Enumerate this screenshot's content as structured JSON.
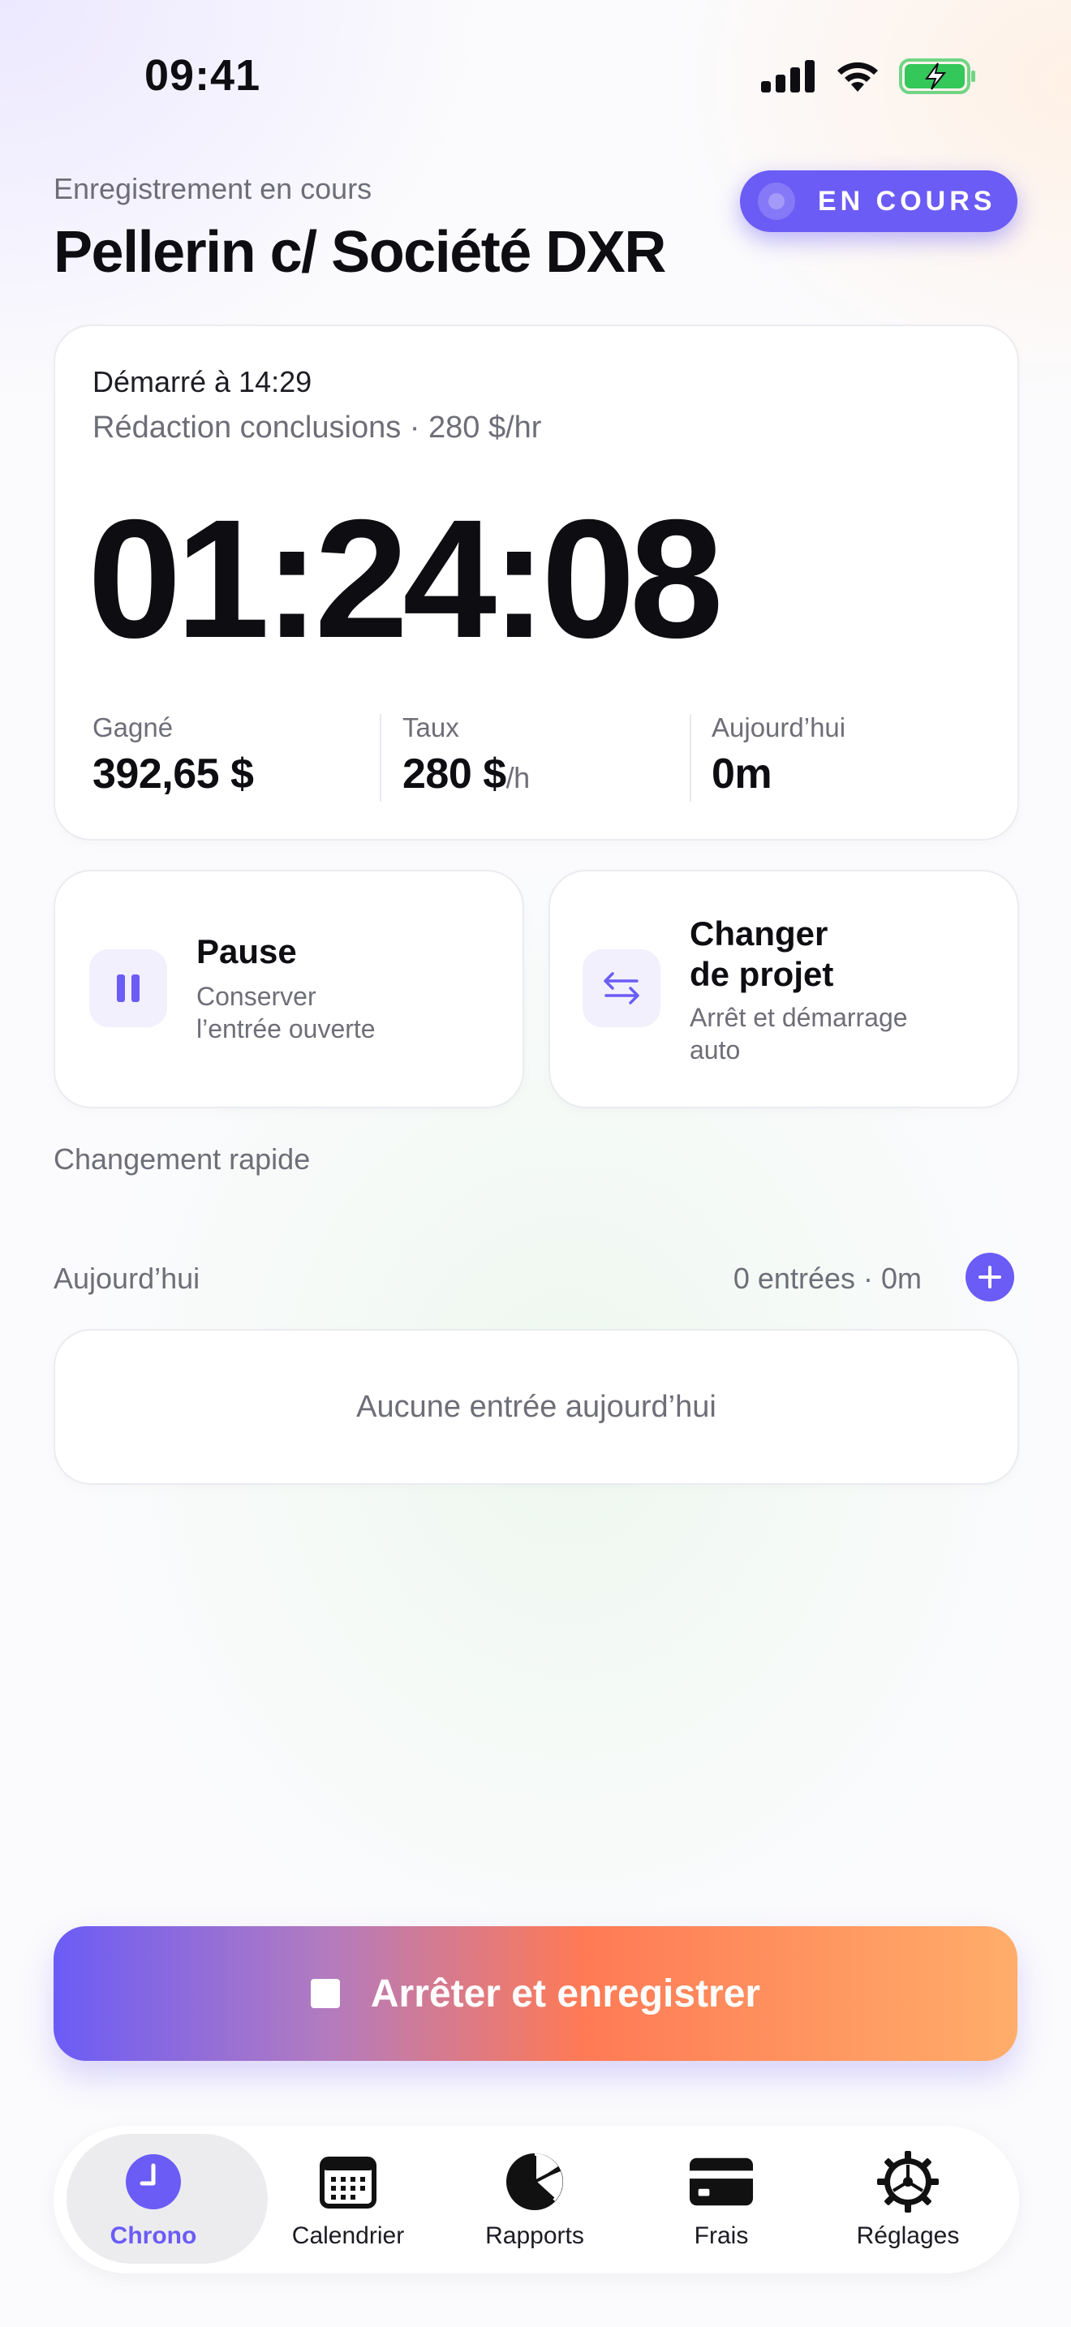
{
  "status_bar": {
    "time": "09:41"
  },
  "header": {
    "subtitle": "Enregistrement en cours",
    "title": "Pellerin c/ Société DXR",
    "status_badge": "EN COURS"
  },
  "timer": {
    "started": "Démarré à 14:29",
    "task": "Rédaction conclusions · 280 $/hr",
    "elapsed": "01:24:08",
    "stats": [
      {
        "label": "Gagné",
        "value": "392,65 $",
        "unit": ""
      },
      {
        "label": "Taux",
        "value": "280 $",
        "unit": "/h"
      },
      {
        "label": "Aujourd’hui",
        "value": "0m",
        "unit": ""
      }
    ]
  },
  "actions": {
    "pause": {
      "title": "Pause",
      "subtitle_line1": "Conserver",
      "subtitle_line2": "l’entrée ouverte",
      "icon": "pause-icon"
    },
    "switch": {
      "title_line1": "Changer",
      "title_line2": "de projet",
      "subtitle_line1": "Arrêt et démarrage",
      "subtitle_line2": "auto",
      "icon": "switch-arrows-icon"
    }
  },
  "quick_switch": {
    "label": "Changement rapide"
  },
  "today": {
    "label": "Aujourd’hui",
    "summary": "0 entrées · 0m",
    "empty": "Aucune entrée aujourd’hui"
  },
  "stop_button": {
    "label": "Arrêter et enregistrer"
  },
  "tabs": [
    {
      "label": "Chrono",
      "icon": "clock-icon",
      "active": true
    },
    {
      "label": "Calendrier",
      "icon": "calendar-icon",
      "active": false
    },
    {
      "label": "Rapports",
      "icon": "pie-chart-icon",
      "active": false
    },
    {
      "label": "Frais",
      "icon": "credit-card-icon",
      "active": false
    },
    {
      "label": "Réglages",
      "icon": "gear-icon",
      "active": false
    }
  ],
  "colors": {
    "accent": "#6b5cf6",
    "gradient_mid": "#ff7a55",
    "gradient_end": "#ffad6a",
    "battery": "#34c759"
  }
}
